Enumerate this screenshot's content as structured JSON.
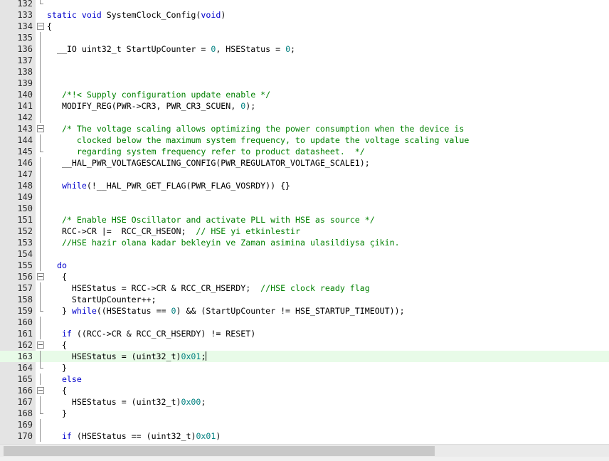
{
  "editor": {
    "language": "C",
    "current_line": 163,
    "lines": [
      {
        "n": "132",
        "fold": "end",
        "tokens": []
      },
      {
        "n": "133",
        "fold": "",
        "tokens": [
          {
            "t": "kw",
            "v": "static void"
          },
          {
            "t": "",
            "v": " SystemClock_Config("
          },
          {
            "t": "kw",
            "v": "void"
          },
          {
            "t": "",
            "v": ")"
          }
        ]
      },
      {
        "n": "134",
        "fold": "box",
        "tokens": [
          {
            "t": "",
            "v": "{"
          }
        ]
      },
      {
        "n": "135",
        "fold": "vline",
        "tokens": []
      },
      {
        "n": "136",
        "fold": "vline",
        "tokens": [
          {
            "t": "",
            "v": "  __IO uint32_t StartUpCounter = "
          },
          {
            "t": "num",
            "v": "0"
          },
          {
            "t": "",
            "v": ", HSEStatus = "
          },
          {
            "t": "num",
            "v": "0"
          },
          {
            "t": "",
            "v": ";"
          }
        ]
      },
      {
        "n": "137",
        "fold": "vline",
        "tokens": []
      },
      {
        "n": "138",
        "fold": "vline",
        "tokens": []
      },
      {
        "n": "139",
        "fold": "vline",
        "tokens": []
      },
      {
        "n": "140",
        "fold": "vline",
        "tokens": [
          {
            "t": "",
            "v": "   "
          },
          {
            "t": "cm",
            "v": "/*!< Supply configuration update enable */"
          }
        ]
      },
      {
        "n": "141",
        "fold": "vline",
        "tokens": [
          {
            "t": "",
            "v": "   MODIFY_REG(PWR->CR3, PWR_CR3_SCUEN, "
          },
          {
            "t": "num",
            "v": "0"
          },
          {
            "t": "",
            "v": ");"
          }
        ]
      },
      {
        "n": "142",
        "fold": "vline",
        "tokens": []
      },
      {
        "n": "143",
        "fold": "box",
        "tokens": [
          {
            "t": "",
            "v": "   "
          },
          {
            "t": "cm",
            "v": "/* The voltage scaling allows optimizing the power consumption when the device is"
          }
        ]
      },
      {
        "n": "144",
        "fold": "vline",
        "tokens": [
          {
            "t": "cm",
            "v": "      clocked below the maximum system frequency, to update the voltage scaling value"
          }
        ]
      },
      {
        "n": "145",
        "fold": "end",
        "tokens": [
          {
            "t": "cm",
            "v": "      regarding system frequency refer to product datasheet.  */"
          }
        ]
      },
      {
        "n": "146",
        "fold": "vline",
        "tokens": [
          {
            "t": "",
            "v": "   __HAL_PWR_VOLTAGESCALING_CONFIG(PWR_REGULATOR_VOLTAGE_SCALE1);"
          }
        ]
      },
      {
        "n": "147",
        "fold": "vline",
        "tokens": []
      },
      {
        "n": "148",
        "fold": "vline",
        "tokens": [
          {
            "t": "",
            "v": "   "
          },
          {
            "t": "kw",
            "v": "while"
          },
          {
            "t": "",
            "v": "(!__HAL_PWR_GET_FLAG(PWR_FLAG_VOSRDY)) {}"
          }
        ]
      },
      {
        "n": "149",
        "fold": "vline",
        "tokens": []
      },
      {
        "n": "150",
        "fold": "vline",
        "tokens": []
      },
      {
        "n": "151",
        "fold": "vline",
        "tokens": [
          {
            "t": "",
            "v": "   "
          },
          {
            "t": "cm",
            "v": "/* Enable HSE Oscillator and activate PLL with HSE as source */"
          }
        ]
      },
      {
        "n": "152",
        "fold": "vline",
        "tokens": [
          {
            "t": "",
            "v": "   RCC->CR |=  RCC_CR_HSEON;  "
          },
          {
            "t": "cm",
            "v": "// HSE yi etkinlestir"
          }
        ]
      },
      {
        "n": "153",
        "fold": "vline",
        "tokens": [
          {
            "t": "",
            "v": "   "
          },
          {
            "t": "cm",
            "v": "//HSE hazir olana kadar bekleyin ve Zaman asimina ulasildiysa çikin."
          }
        ]
      },
      {
        "n": "154",
        "fold": "vline",
        "tokens": []
      },
      {
        "n": "155",
        "fold": "vline",
        "tokens": [
          {
            "t": "",
            "v": "  "
          },
          {
            "t": "kw",
            "v": "do"
          }
        ]
      },
      {
        "n": "156",
        "fold": "box",
        "tokens": [
          {
            "t": "",
            "v": "   {"
          }
        ]
      },
      {
        "n": "157",
        "fold": "vline",
        "tokens": [
          {
            "t": "",
            "v": "     HSEStatus = RCC->CR & RCC_CR_HSERDY;  "
          },
          {
            "t": "cm",
            "v": "//HSE clock ready flag"
          }
        ]
      },
      {
        "n": "158",
        "fold": "vline",
        "tokens": [
          {
            "t": "",
            "v": "     StartUpCounter++;"
          }
        ]
      },
      {
        "n": "159",
        "fold": "end",
        "tokens": [
          {
            "t": "",
            "v": "   } "
          },
          {
            "t": "kw",
            "v": "while"
          },
          {
            "t": "",
            "v": "((HSEStatus == "
          },
          {
            "t": "num",
            "v": "0"
          },
          {
            "t": "",
            "v": ") && (StartUpCounter != HSE_STARTUP_TIMEOUT));"
          }
        ]
      },
      {
        "n": "160",
        "fold": "vline",
        "tokens": []
      },
      {
        "n": "161",
        "fold": "vline",
        "tokens": [
          {
            "t": "",
            "v": "   "
          },
          {
            "t": "kw",
            "v": "if"
          },
          {
            "t": "",
            "v": " ((RCC->CR & RCC_CR_HSERDY) != RESET)"
          }
        ]
      },
      {
        "n": "162",
        "fold": "box",
        "tokens": [
          {
            "t": "",
            "v": "   {"
          }
        ]
      },
      {
        "n": "163",
        "fold": "vline",
        "tokens": [
          {
            "t": "",
            "v": "     HSEStatus = (uint32_t)"
          },
          {
            "t": "num",
            "v": "0x01"
          },
          {
            "t": "",
            "v": ";"
          },
          {
            "t": "caret",
            "v": ""
          }
        ]
      },
      {
        "n": "164",
        "fold": "end",
        "tokens": [
          {
            "t": "",
            "v": "   }"
          }
        ]
      },
      {
        "n": "165",
        "fold": "vline",
        "tokens": [
          {
            "t": "",
            "v": "   "
          },
          {
            "t": "kw",
            "v": "else"
          }
        ]
      },
      {
        "n": "166",
        "fold": "box",
        "tokens": [
          {
            "t": "",
            "v": "   {"
          }
        ]
      },
      {
        "n": "167",
        "fold": "vline",
        "tokens": [
          {
            "t": "",
            "v": "     HSEStatus = (uint32_t)"
          },
          {
            "t": "num",
            "v": "0x00"
          },
          {
            "t": "",
            "v": ";"
          }
        ]
      },
      {
        "n": "168",
        "fold": "end",
        "tokens": [
          {
            "t": "",
            "v": "   }"
          }
        ]
      },
      {
        "n": "169",
        "fold": "vline",
        "tokens": []
      },
      {
        "n": "170",
        "fold": "vline",
        "tokens": [
          {
            "t": "",
            "v": "   "
          },
          {
            "t": "kw",
            "v": "if"
          },
          {
            "t": "",
            "v": " (HSEStatus == (uint32_t)"
          },
          {
            "t": "num",
            "v": "0x01"
          },
          {
            "t": "",
            "v": ")"
          }
        ]
      }
    ]
  },
  "scrollbar": {
    "horizontal_position": 0.0,
    "horizontal_visible_fraction": 0.71
  }
}
